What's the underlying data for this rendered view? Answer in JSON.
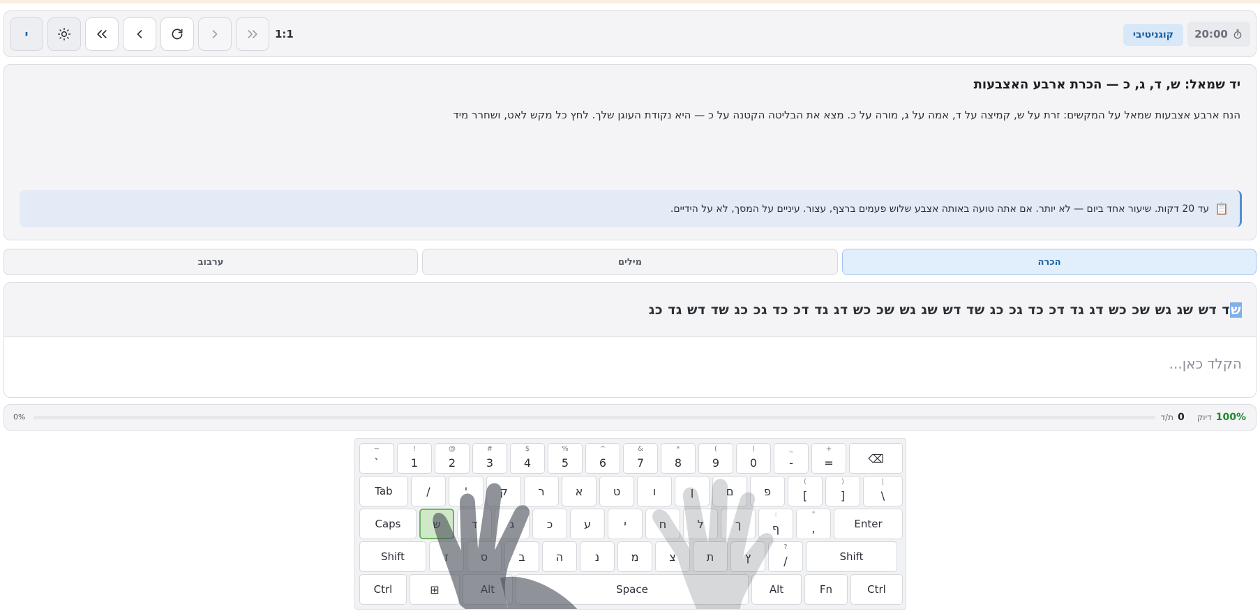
{
  "toolbar": {
    "buttons": [
      {
        "name": "keyboard-layout-button",
        "label": "י"
      },
      {
        "name": "theme-toggle-button",
        "icon": "sun-icon"
      },
      {
        "name": "first-lesson-button",
        "icon": "double-chevron-left-icon"
      },
      {
        "name": "previous-lesson-button",
        "icon": "chevron-left-icon"
      },
      {
        "name": "restart-button",
        "icon": "refresh-icon"
      },
      {
        "name": "next-lesson-button",
        "icon": "chevron-right-icon"
      },
      {
        "name": "last-lesson-button",
        "icon": "double-chevron-right-icon"
      }
    ],
    "ratio": "1:1",
    "mode": "קוגניטיבי",
    "timer": "20:00"
  },
  "lesson": {
    "title": "יד שמאל: ש, ד, ג, כ — הכרת ארבע האצבעות",
    "description": "הנח ארבע אצבעות שמאל על המקשים: זרת על ש, קמיצה על ד, אמה על ג, מורה על כ. מצא את הבליטה הקטנה על כ — היא נקודת העוגן שלך. לחץ כל מקש לאט, ושחרר מיד",
    "note": "עד 20 דקות. שיעור אחד ביום — לא יותר. אם אתה טועה באותה אצבע שלוש פעמים ברצף, עצור. עיניים על המסך, לא על הידיים."
  },
  "tabs": [
    {
      "label": "הכרה",
      "active": true
    },
    {
      "label": "מילים",
      "active": false
    },
    {
      "label": "ערבוב",
      "active": false
    }
  ],
  "typing": {
    "current_char": "ש",
    "remaining_text": "ד דש שג גש שכ כש דג גד דכ כד גכ כג שד דש שג גש שכ כש דג גד דכ כד גכ כג שד דש גד כג",
    "placeholder": "הקלד כאן..."
  },
  "progress": {
    "percent_label": "0%",
    "percent": 0,
    "accuracy_value": "100%",
    "accuracy_label": "דיוק",
    "wpm_value": "0",
    "wpm_label": "ת/ד"
  },
  "keyboard": {
    "rows": [
      [
        {
          "main": "`",
          "sub": "~"
        },
        {
          "main": "1",
          "sub": "!"
        },
        {
          "main": "2",
          "sub": "@"
        },
        {
          "main": "3",
          "sub": "#"
        },
        {
          "main": "4",
          "sub": "$"
        },
        {
          "main": "5",
          "sub": "%"
        },
        {
          "main": "6",
          "sub": "^"
        },
        {
          "main": "7",
          "sub": "&"
        },
        {
          "main": "8",
          "sub": "*"
        },
        {
          "main": "9",
          "sub": "("
        },
        {
          "main": "0",
          "sub": ")"
        },
        {
          "main": "-",
          "sub": "_"
        },
        {
          "main": "=",
          "sub": "+"
        },
        {
          "main": "⌫",
          "sub": "",
          "icon": "backspace-icon"
        }
      ],
      [
        {
          "main": "Tab"
        },
        {
          "main": "/"
        },
        {
          "main": "'"
        },
        {
          "main": "ק"
        },
        {
          "main": "ר"
        },
        {
          "main": "א"
        },
        {
          "main": "ט"
        },
        {
          "main": "ו"
        },
        {
          "main": "ן"
        },
        {
          "main": "ם"
        },
        {
          "main": "פ"
        },
        {
          "main": "[",
          "sub": "("
        },
        {
          "main": "]",
          "sub": ")"
        },
        {
          "main": "\\",
          "sub": "|"
        }
      ],
      [
        {
          "main": "Caps"
        },
        {
          "main": "ש",
          "highlight": true
        },
        {
          "main": "ד"
        },
        {
          "main": "ג"
        },
        {
          "main": "כ"
        },
        {
          "main": "ע"
        },
        {
          "main": "י"
        },
        {
          "main": "ח"
        },
        {
          "main": "ל"
        },
        {
          "main": "ך"
        },
        {
          "main": "ף",
          "sub": ":"
        },
        {
          "main": ",",
          "sub": "\""
        },
        {
          "main": "Enter"
        }
      ],
      [
        {
          "main": "Shift"
        },
        {
          "main": "ז"
        },
        {
          "main": "ס"
        },
        {
          "main": "ב"
        },
        {
          "main": "ה"
        },
        {
          "main": "נ"
        },
        {
          "main": "מ"
        },
        {
          "main": "צ"
        },
        {
          "main": "ת"
        },
        {
          "main": "ץ"
        },
        {
          "main": "/",
          "sub": "?"
        },
        {
          "main": "Shift"
        }
      ],
      [
        {
          "main": "Ctrl"
        },
        {
          "main": "⊞",
          "icon": "windows-icon"
        },
        {
          "main": "Alt"
        },
        {
          "main": "Space"
        },
        {
          "main": "Alt"
        },
        {
          "main": "Fn"
        },
        {
          "main": "Ctrl"
        }
      ]
    ]
  }
}
